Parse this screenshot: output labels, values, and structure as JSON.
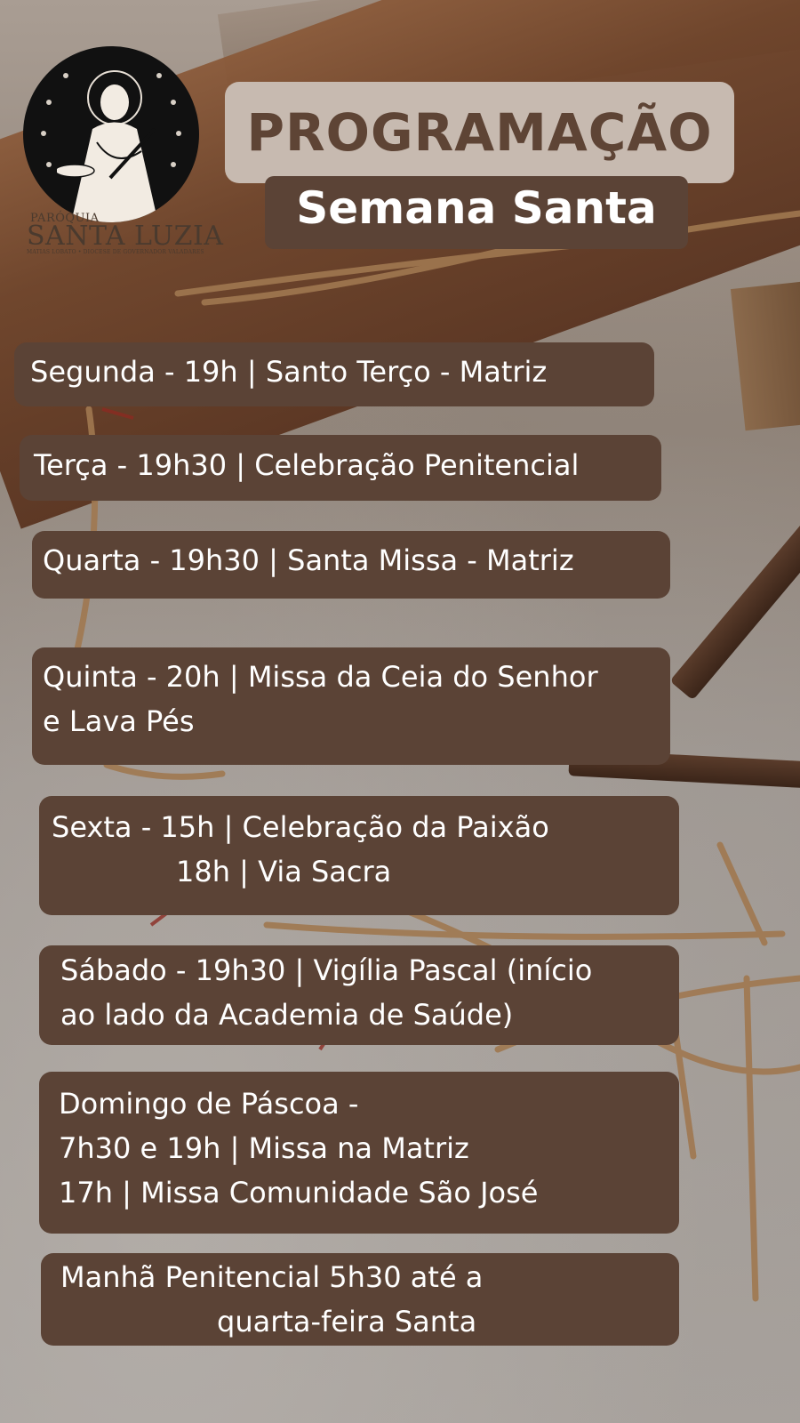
{
  "logo": {
    "small_label": "PARÓQUIA",
    "name": "SANTA LUZIA",
    "subline": "MATIAS LOBATO • DIOCESE DE GOVERNADOR VALADARES"
  },
  "header": {
    "title": "PROGRAMAÇÃO",
    "subtitle": "Semana Santa"
  },
  "schedule": [
    {
      "lines": [
        "Segunda - 19h | Santo Terço - Matriz"
      ]
    },
    {
      "lines": [
        "Terça - 19h30 | Celebração Penitencial"
      ]
    },
    {
      "lines": [
        "Quarta - 19h30 | Santa Missa - Matriz"
      ]
    },
    {
      "lines": [
        "Quinta - 20h | Missa da Ceia do Senhor",
        "e Lava Pés"
      ]
    },
    {
      "lines": [
        "Sexta - 15h | Celebração da Paixão",
        "18h | Via Sacra"
      ]
    },
    {
      "lines": [
        "Sábado - 19h30 | Vigília Pascal (início",
        "ao lado da Academia de Saúde)"
      ]
    },
    {
      "lines": [
        "Domingo de Páscoa  -",
        "7h30 e 19h | Missa na Matriz",
        "17h | Missa Comunidade São José"
      ]
    },
    {
      "lines": [
        "Manhã Penitencial 5h30 até a",
        "quarta-feira Santa"
      ]
    }
  ],
  "colors": {
    "box_dark": "#5b4336",
    "box_light": "#c7bab0",
    "title_text": "#5e4435"
  }
}
